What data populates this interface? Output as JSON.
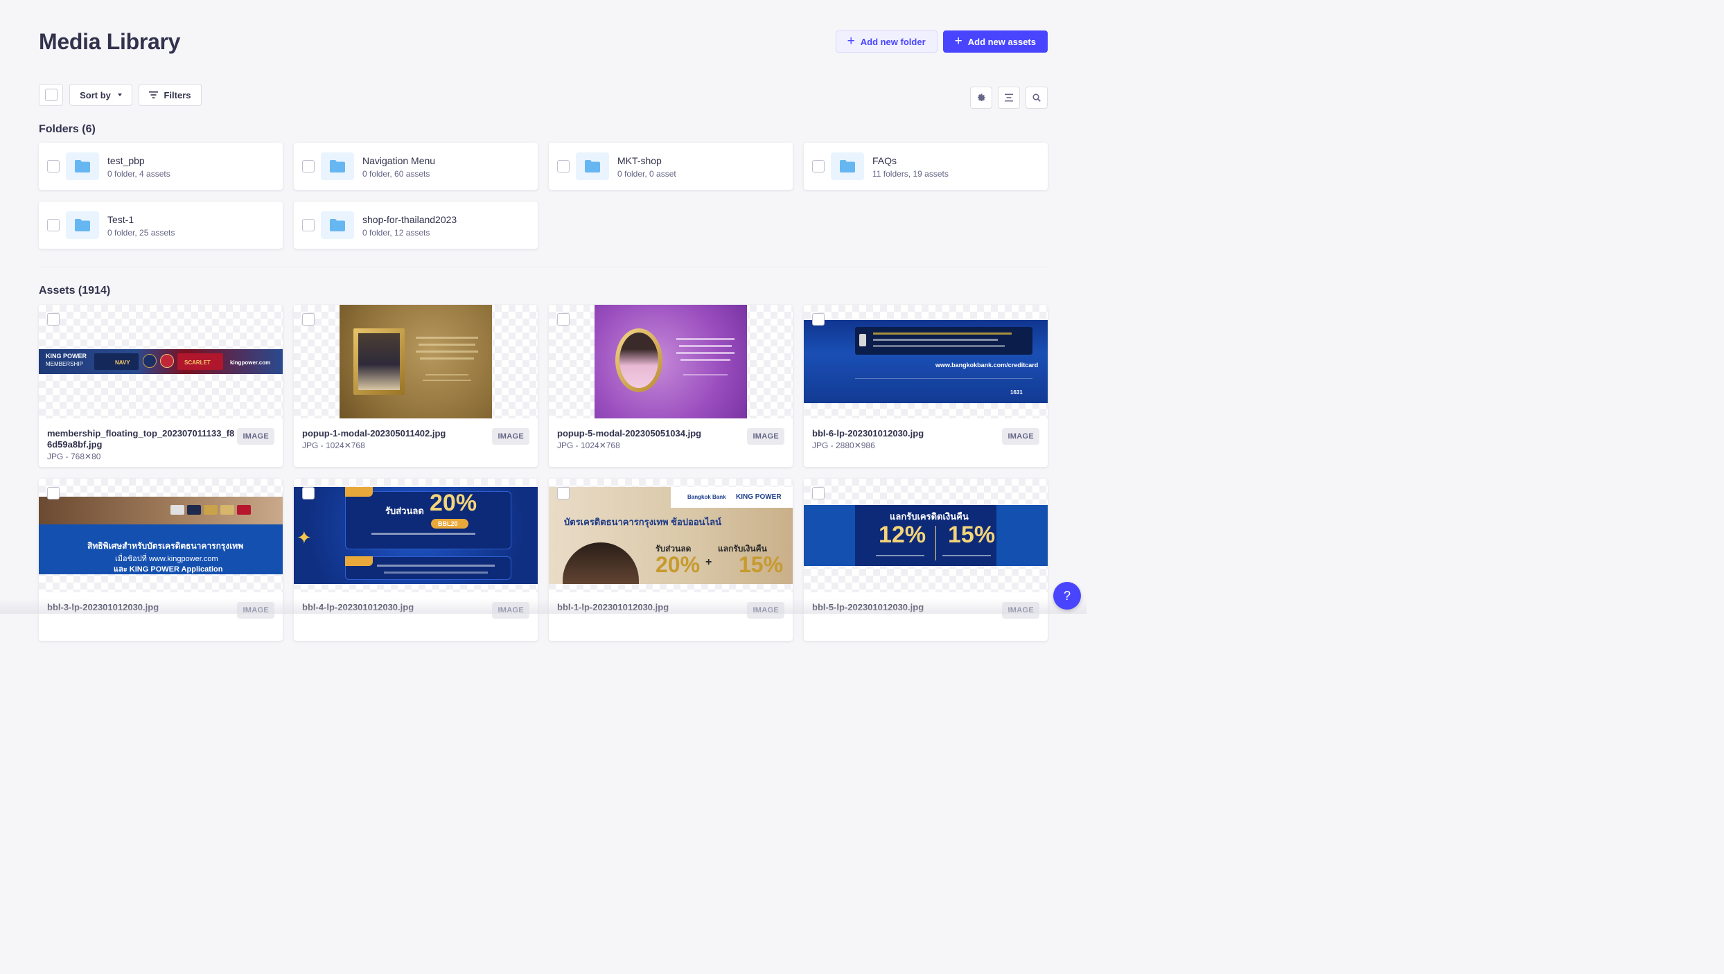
{
  "header": {
    "title": "Media Library",
    "add_folder_label": "Add new folder",
    "add_assets_label": "Add new assets"
  },
  "toolbar": {
    "sort_label": "Sort by",
    "filters_label": "Filters",
    "icons": [
      "gear-icon",
      "list-view-icon",
      "search-icon"
    ]
  },
  "folders": {
    "title": "Folders (6)",
    "items": [
      {
        "name": "test_pbp",
        "meta": "0 folder, 4 assets"
      },
      {
        "name": "Navigation Menu",
        "meta": "0 folder, 60 assets"
      },
      {
        "name": "MKT-shop",
        "meta": "0 folder, 0 asset"
      },
      {
        "name": "FAQs",
        "meta": "11 folders, 19 assets"
      },
      {
        "name": "Test-1",
        "meta": "0 folder, 25 assets"
      },
      {
        "name": "shop-for-thailand2023",
        "meta": "0 folder, 12 assets"
      }
    ]
  },
  "assets": {
    "title": "Assets (1914)",
    "items": [
      {
        "name": "membership_floating_top_202307011133_f86d59a8bf.jpg",
        "meta": "JPG - 768✕80",
        "badge": "IMAGE"
      },
      {
        "name": "popup-1-modal-202305011402.jpg",
        "meta": "JPG - 1024✕768",
        "badge": "IMAGE"
      },
      {
        "name": "popup-5-modal-202305051034.jpg",
        "meta": "JPG - 1024✕768",
        "badge": "IMAGE"
      },
      {
        "name": "bbl-6-lp-202301012030.jpg",
        "meta": "JPG - 2880✕986",
        "badge": "IMAGE"
      },
      {
        "name": "bbl-3-lp-202301012030.jpg",
        "meta": "",
        "badge": "IMAGE"
      },
      {
        "name": "bbl-4-lp-202301012030.jpg",
        "meta": "",
        "badge": "IMAGE"
      },
      {
        "name": "bbl-1-lp-202301012030.jpg",
        "meta": "",
        "badge": "IMAGE"
      },
      {
        "name": "bbl-5-lp-202301012030.jpg",
        "meta": "",
        "badge": "IMAGE"
      }
    ]
  },
  "artwork": {
    "a1": {
      "brand": "KING POWER",
      "sub": "MEMBERSHIP",
      "tier1": "NAVY",
      "tier2": "SCARLET",
      "site": "kingpower.com"
    },
    "a4": {
      "url": "www.bangkokbank.com/creditcard",
      "num": "1631"
    },
    "a5": {
      "line1": "สิทธิพิเศษสำหรับบัตรเครดิตธนาคารกรุงเทพ",
      "line2": "เมื่อช้อปที่ www.kingpower.com",
      "line3": "และ KING POWER Application"
    },
    "a6": {
      "pct": "20%",
      "label": "รับส่วนลด",
      "code": "BBL20"
    },
    "a7": {
      "bank": "Bangkok Bank",
      "brand": "KING POWER",
      "headline": "บัตรเครดิตธนาคารกรุงเทพ ช้อปออนไลน์",
      "pct1": "20%",
      "pct2": "15%",
      "label1": "รับส่วนลด",
      "label2": "แลกรับเงินคืน"
    },
    "a8": {
      "headline": "แลกรับเครดิตเงินคืน",
      "pct1": "12%",
      "pct2": "15%"
    }
  },
  "help_label": "?"
}
